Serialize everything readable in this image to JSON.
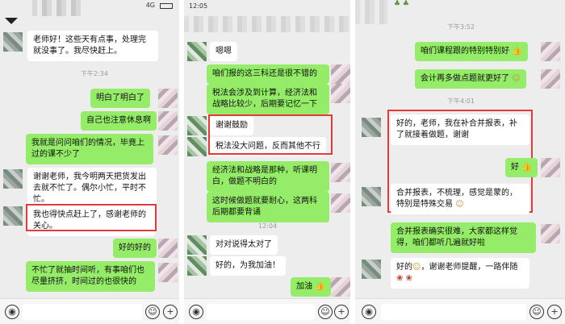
{
  "panel1": {
    "status_bar": "4G",
    "messages": [
      {
        "text": "老师好！这些天有点事，处理完就没事了。我尽快赶上。",
        "side": "in"
      },
      {
        "text": "下午2:34",
        "type": "time"
      },
      {
        "text": "明白了明白了",
        "side": "out"
      },
      {
        "text": "自己也注意休息啊",
        "side": "out"
      },
      {
        "text": "我就是问问咱们的情况，毕竟上过的课不少了",
        "side": "out"
      },
      {
        "text": "谢谢老师，我今明两天把货发出去就不忙了。偶尔小忙，平时不忙。",
        "side": "in"
      },
      {
        "text": "我也得快点赶上了，感谢老师的关心。",
        "side": "in"
      },
      {
        "text": "好的好的",
        "side": "out"
      },
      {
        "text": "不忙了就抽时间听，有事咱们也尽量挤挤，时间过的也很快的",
        "side": "out"
      }
    ]
  },
  "panel2": {
    "status_time": "12:05",
    "messages": [
      {
        "text": "嗯嗯",
        "side": "in"
      },
      {
        "text": "咱们报的这三科还是很不错的",
        "side": "out"
      },
      {
        "text": "税法会涉及到计算，经济法和战略比较少，后期要记忆一下",
        "side": "out"
      },
      {
        "text": "谢谢鼓励",
        "side": "in"
      },
      {
        "text": "税法没大问题，反而其他不行",
        "side": "in"
      },
      {
        "text": "经济法和战略是那种，听课明白，做题不明白的",
        "side": "out"
      },
      {
        "text": "这时候做题就要耐心，这两科后期都要背诵",
        "side": "out"
      },
      {
        "text": "12:04",
        "type": "time"
      },
      {
        "text": "对对说得太对了",
        "side": "in"
      },
      {
        "text": "好的，为我加油！",
        "side": "in"
      },
      {
        "text": "加油",
        "side": "out"
      }
    ]
  },
  "panel3": {
    "messages": [
      {
        "text": "下午3:52",
        "type": "time"
      },
      {
        "text": "咱们课程跟的特别特别好",
        "side": "out"
      },
      {
        "text": "会计再多做点题就更好了",
        "side": "out"
      },
      {
        "text": "下午4:01",
        "type": "time"
      },
      {
        "text": "好的，老师，我在补合并报表，补了就接着做题，谢谢",
        "side": "in"
      },
      {
        "text": "好",
        "side": "out"
      },
      {
        "text": "合并报表，不梳理，感觉是蒙的，特别是特殊交易",
        "side": "in"
      },
      {
        "text": "合并报表确实很难，大家都这样觉得，咱们都听几遍就好啦",
        "side": "out"
      },
      {
        "text": "好的",
        "side": "in"
      },
      {
        "text": "，谢谢老师提醒，一路伴随",
        "side": "in"
      }
    ]
  },
  "icons": {
    "voice": "voice-icon",
    "emoji": "emoji-icon",
    "plus": "plus-icon"
  },
  "colors": {
    "outgoing": "#95ec69",
    "incoming": "#ffffff",
    "highlight": "#e33b3b"
  }
}
